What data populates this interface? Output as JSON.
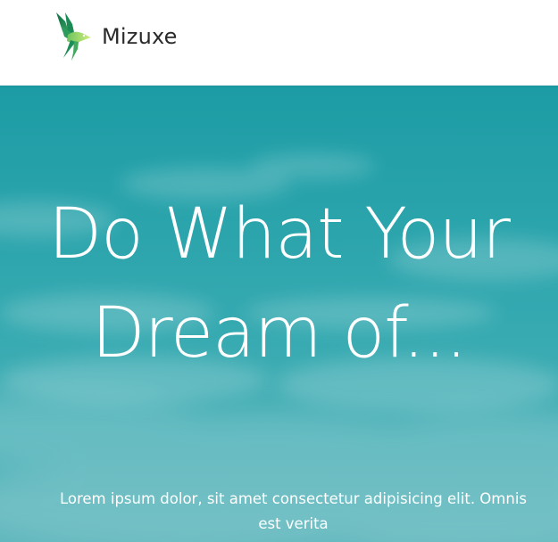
{
  "header": {
    "brand_name": "Mizuxe",
    "logo_icon": "bird-icon",
    "colors": {
      "background": "#ffffff",
      "text": "#2a2a2a",
      "logo_green_dark": "#1f7f4f",
      "logo_green_light": "#b8e46a"
    }
  },
  "hero": {
    "title": "Do What Your Dream of...",
    "text": "Lorem ipsum dolor, sit amet consectetur adipisicing elit. Omnis est verita",
    "background_color": "#2aa8b0",
    "text_color": "#ffffff"
  }
}
